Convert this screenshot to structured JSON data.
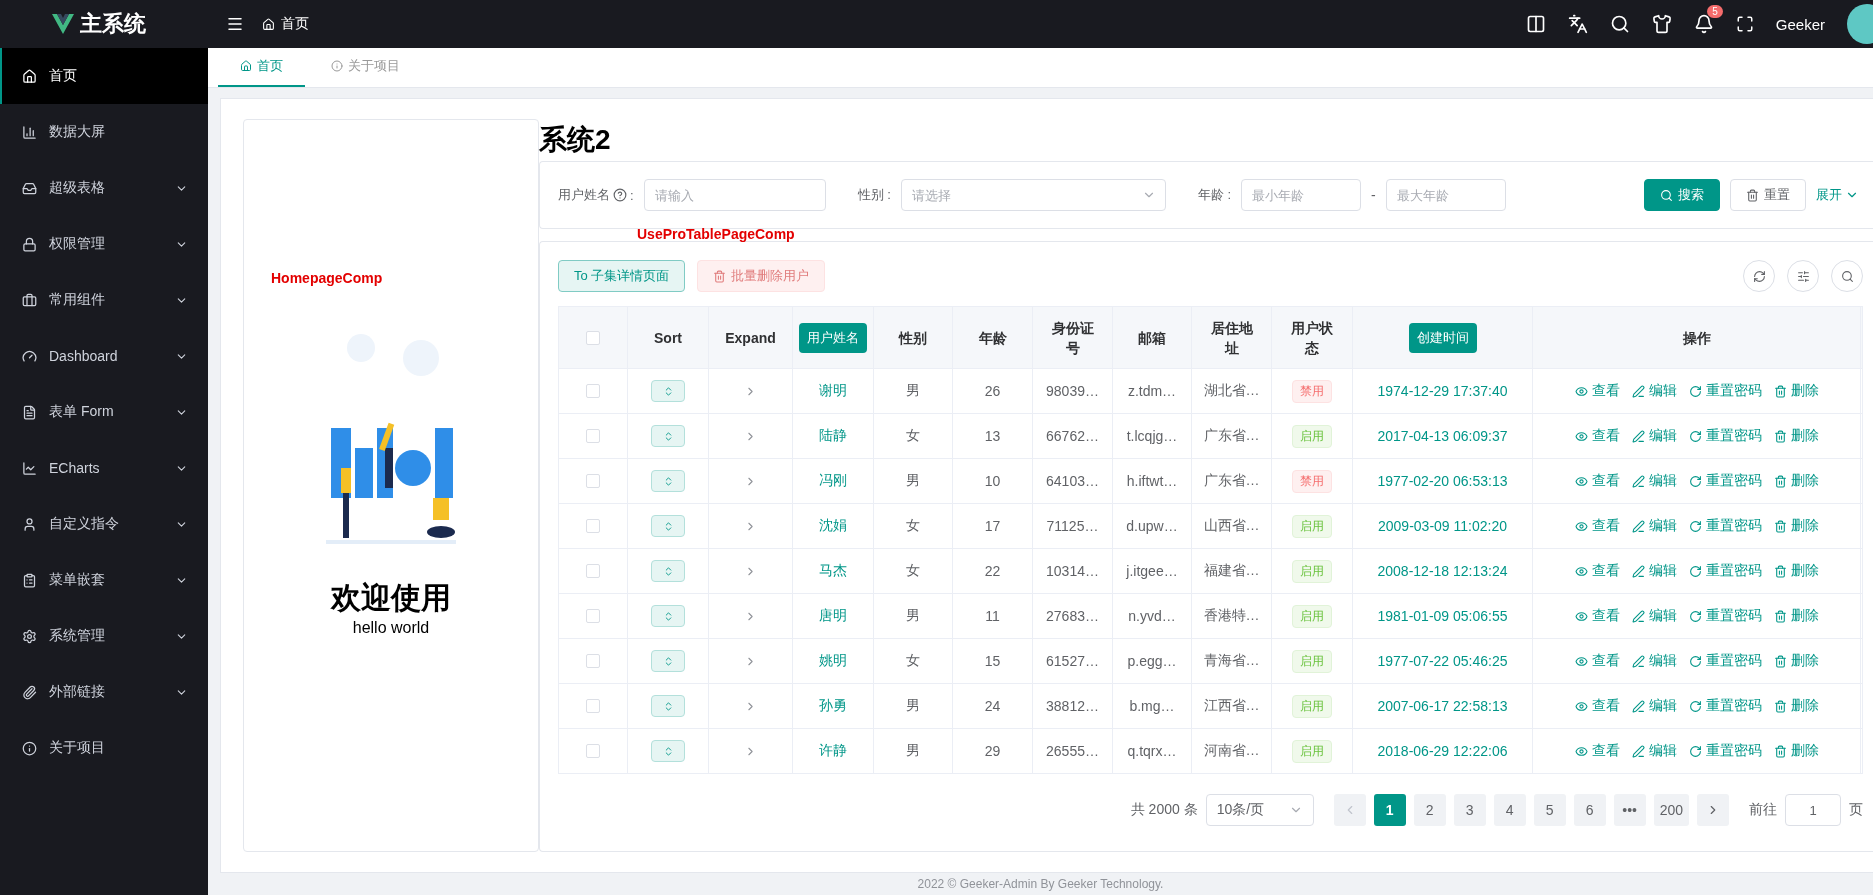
{
  "header": {
    "logo_text": "主系统",
    "breadcrumb": "首页",
    "notification_count": "5",
    "username": "Geeker"
  },
  "sidebar": {
    "items": [
      {
        "label": "首页",
        "selected": true,
        "expandable": false
      },
      {
        "label": "数据大屏",
        "selected": false,
        "expandable": false
      },
      {
        "label": "超级表格",
        "selected": false,
        "expandable": true
      },
      {
        "label": "权限管理",
        "selected": false,
        "expandable": true
      },
      {
        "label": "常用组件",
        "selected": false,
        "expandable": true
      },
      {
        "label": "Dashboard",
        "selected": false,
        "expandable": true
      },
      {
        "label": "表单 Form",
        "selected": false,
        "expandable": true
      },
      {
        "label": "ECharts",
        "selected": false,
        "expandable": true
      },
      {
        "label": "自定义指令",
        "selected": false,
        "expandable": true
      },
      {
        "label": "菜单嵌套",
        "selected": false,
        "expandable": true
      },
      {
        "label": "系统管理",
        "selected": false,
        "expandable": true
      },
      {
        "label": "外部链接",
        "selected": false,
        "expandable": true
      },
      {
        "label": "关于项目",
        "selected": false,
        "expandable": false
      }
    ]
  },
  "tabs": [
    {
      "label": "首页",
      "selected": true
    },
    {
      "label": "关于项目",
      "selected": false
    }
  ],
  "homepage_comp": {
    "tag": "HomepageComp",
    "title": "欢迎使用",
    "subtitle": "hello world"
  },
  "system_title": "系统2",
  "search_form": {
    "name_label": "用户姓名",
    "name_colon": ":",
    "name_placeholder": "请输入",
    "gender_label": "性别 :",
    "gender_placeholder": "请选择",
    "age_label": "年龄 :",
    "age_min_placeholder": "最小年龄",
    "age_separator": "-",
    "age_max_placeholder": "最大年龄",
    "search_button": "搜索",
    "reset_button": "重置",
    "expand_link": "展开"
  },
  "table_comp_tag": "UseProTablePageComp",
  "toolbar": {
    "buttons": [
      {
        "label": "To 子集详情页面",
        "disabled": false
      },
      {
        "label": "批量删除用户",
        "disabled": true
      }
    ]
  },
  "table": {
    "select_all_checked": false,
    "columns": [
      {
        "kind": "check"
      },
      {
        "label": "Sort",
        "kind": "text"
      },
      {
        "label": "Expand",
        "kind": "text"
      },
      {
        "label": "用户姓名",
        "kind": "button"
      },
      {
        "label": "性别",
        "kind": "text"
      },
      {
        "label": "年龄",
        "kind": "text"
      },
      {
        "label": "身份证号",
        "kind": "text"
      },
      {
        "label": "邮箱",
        "kind": "text"
      },
      {
        "label": "居住地址",
        "kind": "text"
      },
      {
        "label": "用户状态",
        "kind": "text"
      },
      {
        "label": "创建时间",
        "kind": "button"
      },
      {
        "label": "操作",
        "kind": "text"
      }
    ],
    "rows": [
      {
        "checked": false,
        "name": "谢明",
        "gender": "男",
        "age": "26",
        "id": "98039…",
        "email": "z.tdm…",
        "address": "湖北省…",
        "status": "禁用",
        "status_active": false,
        "created": "1974-12-29 17:37:40",
        "actions": [
          "查看",
          "编辑",
          "重置密码",
          "删除"
        ]
      },
      {
        "checked": false,
        "name": "陆静",
        "gender": "女",
        "age": "13",
        "id": "66762…",
        "email": "t.lcqjg…",
        "address": "广东省…",
        "status": "启用",
        "status_active": true,
        "created": "2017-04-13 06:09:37",
        "actions": [
          "查看",
          "编辑",
          "重置密码",
          "删除"
        ]
      },
      {
        "checked": false,
        "name": "冯刚",
        "gender": "男",
        "age": "10",
        "id": "64103…",
        "email": "h.iftwt…",
        "address": "广东省…",
        "status": "禁用",
        "status_active": false,
        "created": "1977-02-20 06:53:13",
        "actions": [
          "查看",
          "编辑",
          "重置密码",
          "删除"
        ]
      },
      {
        "checked": false,
        "name": "沈娟",
        "gender": "女",
        "age": "17",
        "id": "71125…",
        "email": "d.upw…",
        "address": "山西省…",
        "status": "启用",
        "status_active": true,
        "created": "2009-03-09 11:02:20",
        "actions": [
          "查看",
          "编辑",
          "重置密码",
          "删除"
        ]
      },
      {
        "checked": false,
        "name": "马杰",
        "gender": "女",
        "age": "22",
        "id": "10314…",
        "email": "j.itgee…",
        "address": "福建省…",
        "status": "启用",
        "status_active": true,
        "created": "2008-12-18 12:13:24",
        "actions": [
          "查看",
          "编辑",
          "重置密码",
          "删除"
        ]
      },
      {
        "checked": false,
        "name": "唐明",
        "gender": "男",
        "age": "11",
        "id": "27683…",
        "email": "n.yvd…",
        "address": "香港特…",
        "status": "启用",
        "status_active": true,
        "created": "1981-01-09 05:06:55",
        "actions": [
          "查看",
          "编辑",
          "重置密码",
          "删除"
        ]
      },
      {
        "checked": false,
        "name": "姚明",
        "gender": "女",
        "age": "15",
        "id": "61527…",
        "email": "p.egg…",
        "address": "青海省…",
        "status": "启用",
        "status_active": true,
        "created": "1977-07-22 05:46:25",
        "actions": [
          "查看",
          "编辑",
          "重置密码",
          "删除"
        ]
      },
      {
        "checked": false,
        "name": "孙勇",
        "gender": "男",
        "age": "24",
        "id": "38812…",
        "email": "b.mg…",
        "address": "江西省…",
        "status": "启用",
        "status_active": true,
        "created": "2007-06-17 22:58:13",
        "actions": [
          "查看",
          "编辑",
          "重置密码",
          "删除"
        ]
      },
      {
        "checked": false,
        "name": "许静",
        "gender": "男",
        "age": "29",
        "id": "26555…",
        "email": "q.tqrx…",
        "address": "河南省…",
        "status": "启用",
        "status_active": true,
        "created": "2018-06-29 12:22:06",
        "actions": [
          "查看",
          "编辑",
          "重置密码",
          "删除"
        ]
      }
    ]
  },
  "pagination": {
    "total": "共 2000 条",
    "page_size": "10条/页",
    "pages": [
      {
        "label": "1",
        "selected": true
      },
      {
        "label": "2",
        "selected": false
      },
      {
        "label": "3",
        "selected": false
      },
      {
        "label": "4",
        "selected": false
      },
      {
        "label": "5",
        "selected": false
      },
      {
        "label": "6",
        "selected": false
      },
      {
        "label": "•••",
        "selected": false
      },
      {
        "label": "200",
        "selected": false
      }
    ],
    "goto_label": "前往",
    "goto_value": "1",
    "goto_suffix": "页"
  },
  "footer": "2022 © Geeker-Admin By Geeker Technology."
}
